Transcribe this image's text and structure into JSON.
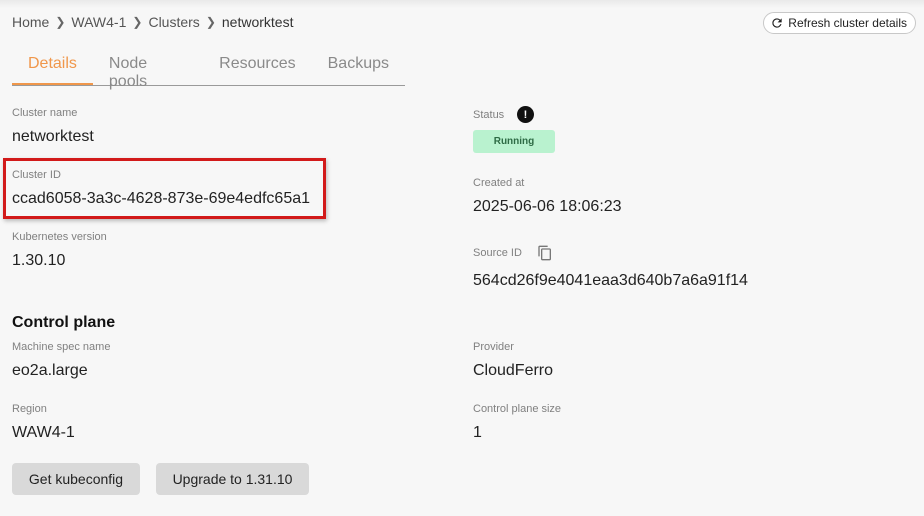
{
  "breadcrumb": {
    "items": [
      "Home",
      "WAW4-1",
      "Clusters"
    ],
    "current": "networktest"
  },
  "header": {
    "refresh_label": "Refresh cluster details"
  },
  "tabs": [
    {
      "label": "Details",
      "active": true
    },
    {
      "label": "Node pools",
      "active": false
    },
    {
      "label": "Resources",
      "active": false
    },
    {
      "label": "Backups",
      "active": false
    }
  ],
  "details": {
    "cluster_name_label": "Cluster name",
    "cluster_name": "networktest",
    "cluster_id_label": "Cluster ID",
    "cluster_id": "ccad6058-3a3c-4628-873e-69e4edfc65a1",
    "k8s_version_label": "Kubernetes version",
    "k8s_version": "1.30.10",
    "status_label": "Status",
    "status": "Running",
    "created_label": "Created at",
    "created_at": "2025-06-06 18:06:23",
    "source_id_label": "Source ID",
    "source_id": "564cd26f9e4041eaa3d640b7a6a91f14"
  },
  "control_plane": {
    "title": "Control plane",
    "machine_spec_label": "Machine spec name",
    "machine_spec": "eo2a.large",
    "provider_label": "Provider",
    "provider": "CloudFerro",
    "region_label": "Region",
    "region": "WAW4-1",
    "size_label": "Control plane size",
    "size": "1"
  },
  "actions": {
    "kubeconfig_label": "Get kubeconfig",
    "upgrade_label": "Upgrade to 1.31.10"
  },
  "colors": {
    "accent": "#f0974b",
    "status_bg": "#b9f2cf",
    "highlight": "#d21a1a"
  },
  "icons": [
    "refresh-icon",
    "chevron-right-icon",
    "info-icon",
    "copy-icon"
  ]
}
